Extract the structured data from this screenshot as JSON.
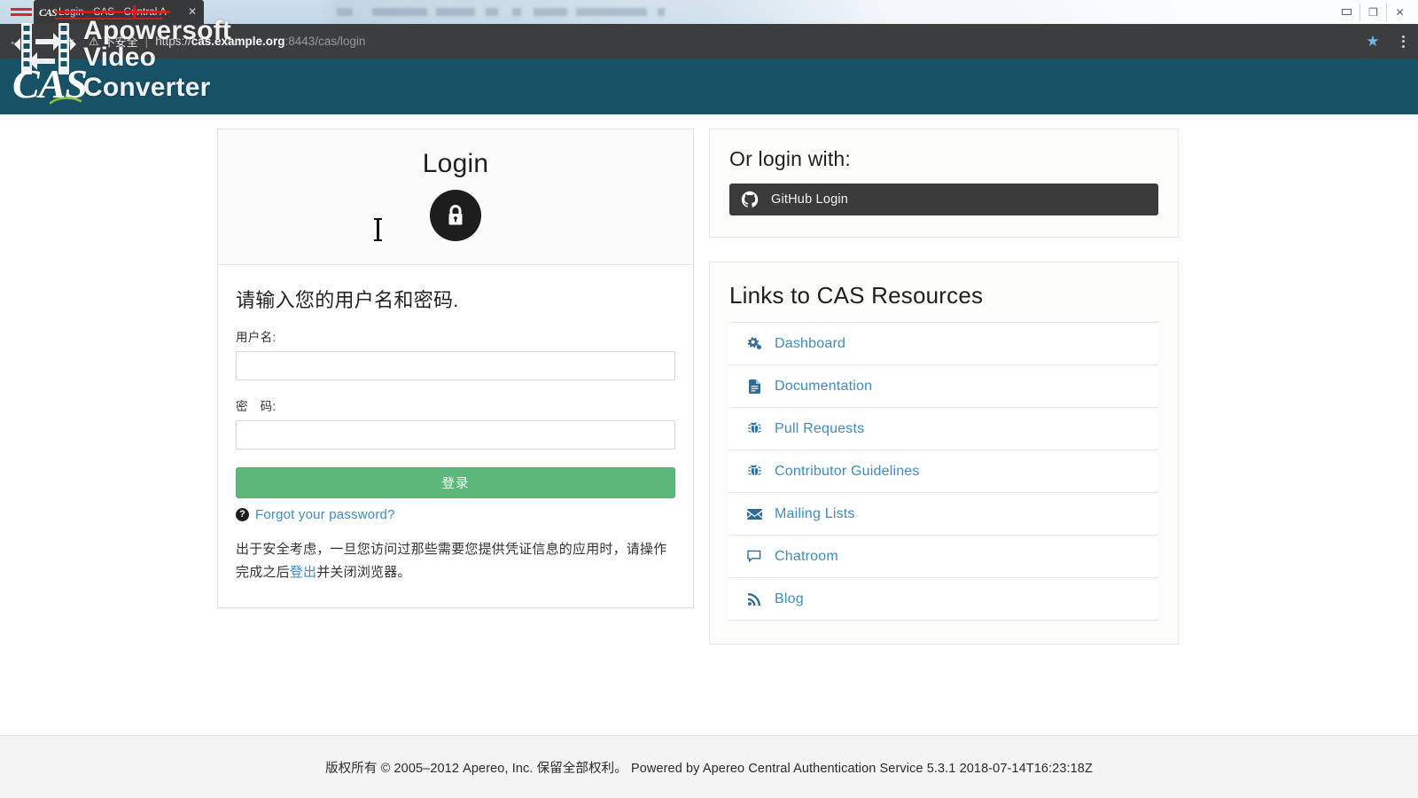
{
  "browser": {
    "tab": {
      "title": "Login - CAS - Central A",
      "favicon": "cas-favicon",
      "close_glyph": "✕"
    },
    "nav": {
      "back_glyph": "←",
      "forward_glyph": "→",
      "reload_glyph": "⟳"
    },
    "omnibox": {
      "security_icon": "not-secure-warning-icon",
      "security_text": "不安全",
      "separator": "|",
      "url_scheme": "https://",
      "url_host": "cas.example.org",
      "url_rest": ":8443/cas/login",
      "full_url": "https://cas.example.org:8443/cas/login"
    },
    "star_glyph": "★",
    "window_controls": {
      "minimize": "minimize-icon",
      "restore": "❐",
      "close": "✕"
    }
  },
  "watermark": {
    "line1": "Apowersoft",
    "line2": "Video Converter",
    "icon": "film-convert-icon"
  },
  "banner": {
    "logo_text": "CAS",
    "bg_color": "#175266"
  },
  "login": {
    "title": "Login",
    "lock_icon": "lock-icon",
    "instructions": "请输入您的用户名和密码.",
    "username_label": "用户名:",
    "username_value": "",
    "username_placeholder": "",
    "password_label": "密　码:",
    "password_value": "",
    "password_placeholder": "",
    "submit_label": "登录",
    "submit_color": "#5cb87a",
    "forgot_icon": "question-circle-icon",
    "forgot_label": "Forgot your password?",
    "security_note_part1": "出于安全考虑，一旦您访问过那些需要您提供凭证信息的应用时，请操作完成之后",
    "security_note_link": "登出",
    "security_note_part2": "并关闭浏览器。"
  },
  "oauth": {
    "title": "Or login with:",
    "github_icon": "github-icon",
    "github_label": "GitHub Login",
    "github_color": "#3b3b3b"
  },
  "resources": {
    "title": "Links to CAS Resources",
    "items": [
      {
        "icon": "cogs-icon",
        "glyph": "⚙",
        "label": "Dashboard"
      },
      {
        "icon": "file-icon",
        "glyph": "☲",
        "label": "Documentation"
      },
      {
        "icon": "bug-icon",
        "glyph": "☣",
        "label": "Pull Requests"
      },
      {
        "icon": "bug-icon",
        "glyph": "☣",
        "label": "Contributor Guidelines"
      },
      {
        "icon": "envelope-icon",
        "glyph": "✉",
        "label": "Mailing Lists"
      },
      {
        "icon": "comment-icon",
        "glyph": "▭",
        "label": "Chatroom"
      },
      {
        "icon": "rss-icon",
        "glyph": "◠",
        "label": "Blog"
      }
    ]
  },
  "footer": {
    "text": "版权所有 © 2005–2012 Apereo, Inc. 保留全部权利。 Powered by Apereo Central Authentication Service 5.3.1 2018-07-14T16:23:18Z"
  }
}
